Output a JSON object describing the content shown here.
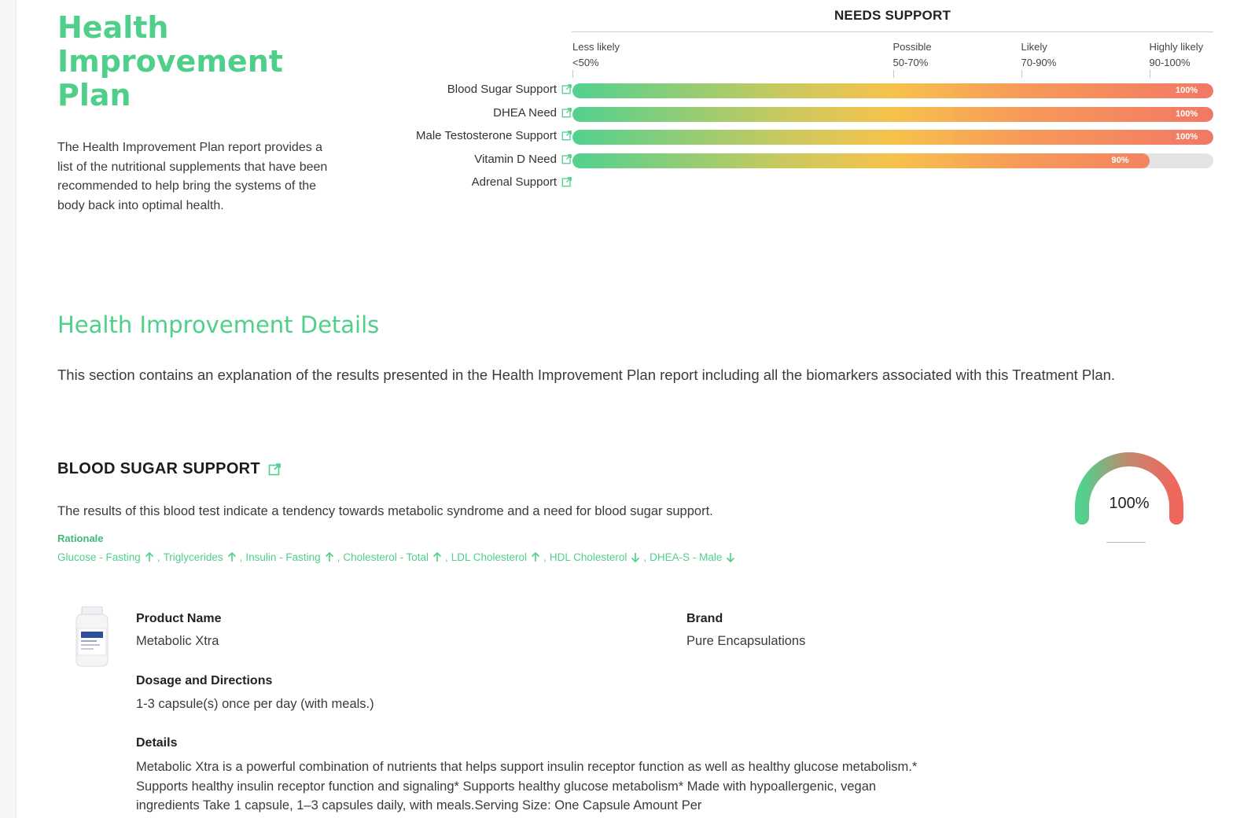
{
  "header": {
    "title": "Health Improvement Plan",
    "intro": "The Health Improvement Plan report provides a list of the nutritional supplements that have been recommended to help bring the systems of the body back into optimal health."
  },
  "needs_support": {
    "title": "NEEDS SUPPORT",
    "ticks": [
      {
        "label": "Less likely",
        "range": "<50%"
      },
      {
        "label": "Possible",
        "range": "50-70%"
      },
      {
        "label": "Likely",
        "range": "70-90%"
      },
      {
        "label": "Highly likely",
        "range": "90-100%"
      }
    ],
    "rows": [
      {
        "label": "Blood Sugar Support",
        "value": 100,
        "value_label": "100%"
      },
      {
        "label": "DHEA Need",
        "value": 100,
        "value_label": "100%"
      },
      {
        "label": "Male Testosterone Support",
        "value": 100,
        "value_label": "100%"
      },
      {
        "label": "Vitamin D Need",
        "value": 90,
        "value_label": "90%"
      },
      {
        "label": "Adrenal Support",
        "value": null,
        "value_label": ""
      }
    ]
  },
  "details": {
    "title": "Health Improvement Details",
    "description": "This section contains an explanation of the results presented in the Health Improvement Plan report including all the biomarkers associated with this Treatment Plan."
  },
  "blood_sugar": {
    "title": "BLOOD SUGAR SUPPORT",
    "description": "The results of this blood test indicate a tendency towards metabolic syndrome and a need for blood sugar support.",
    "rationale_label": "Rationale",
    "rationale": [
      {
        "name": "Glucose - Fasting",
        "direction": "up"
      },
      {
        "name": "Triglycerides",
        "direction": "up"
      },
      {
        "name": "Insulin - Fasting",
        "direction": "up"
      },
      {
        "name": "Cholesterol - Total",
        "direction": "up"
      },
      {
        "name": "LDL Cholesterol",
        "direction": "up"
      },
      {
        "name": "HDL Cholesterol",
        "direction": "down"
      },
      {
        "name": "DHEA-S - Male",
        "direction": "down"
      }
    ],
    "gauge_value": "100%",
    "gauge_fraction": 1.0
  },
  "product": {
    "name_label": "Product Name",
    "name": "Metabolic Xtra",
    "brand_label": "Brand",
    "brand": "Pure Encapsulations",
    "dosage_label": "Dosage and Directions",
    "dosage": "1-3 capsule(s) once per day (with meals.)",
    "details_label": "Details",
    "details": "Metabolic Xtra is a powerful combination of nutrients that helps support insulin receptor function as well as healthy glucose metabolism.* Supports healthy insulin receptor function and signaling* Supports healthy glucose metabolism* Made with hypoallergenic, vegan ingredients Take 1 capsule, 1–3 capsules daily, with meals.Serving Size: One Capsule Amount Per"
  },
  "colors": {
    "accent_green": "#4fcf8a",
    "bar_start": "#52d18f",
    "bar_mid": "#f7c24c",
    "bar_end": "#f27865",
    "track": "#e4e4e4"
  }
}
